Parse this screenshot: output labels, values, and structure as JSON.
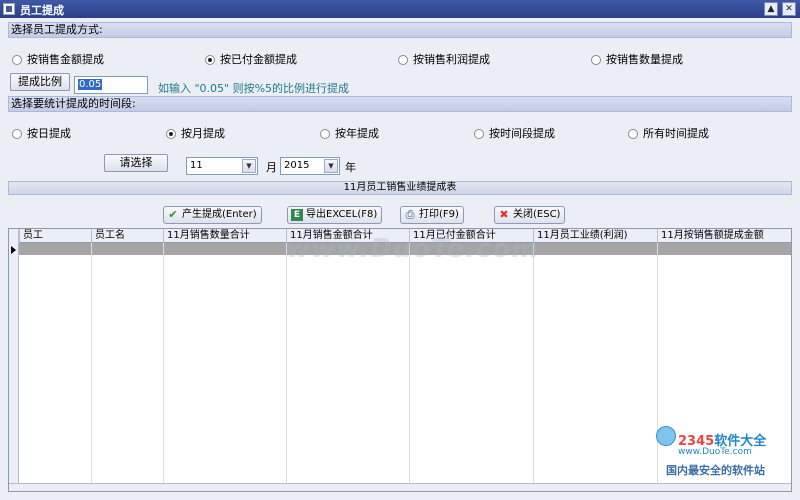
{
  "window": {
    "title": "员工提成",
    "pin_glyph": "▲",
    "close_glyph": "✕"
  },
  "method_section": {
    "label": "选择员工提成方式:",
    "options": [
      {
        "label": "按销售金额提成",
        "checked": false
      },
      {
        "label": "按已付金额提成",
        "checked": true
      },
      {
        "label": "按销售利润提成",
        "checked": false
      },
      {
        "label": "按销售数量提成",
        "checked": false
      }
    ]
  },
  "ratio": {
    "button_label": "提成比例",
    "value": "0.05",
    "hint": "如输入 \"0.05\" 则按%5的比例进行提成"
  },
  "period_section": {
    "label": "选择要统计提成的时间段:",
    "options": [
      {
        "label": "按日提成",
        "checked": false
      },
      {
        "label": "按月提成",
        "checked": true
      },
      {
        "label": "按年提成",
        "checked": false
      },
      {
        "label": "按时间段提成",
        "checked": false
      },
      {
        "label": "所有时间提成",
        "checked": false
      }
    ],
    "choose_button": "请选择",
    "month_value": "11",
    "month_unit": "月",
    "year_value": "2015",
    "year_unit": "年",
    "combo_arrow": "▼"
  },
  "report_title": "11月员工销售业绩提成表",
  "actions": [
    {
      "label": "产生提成(Enter)",
      "icon": "check-icon",
      "glyph": "✔",
      "color": "#2E8B2E"
    },
    {
      "label": "导出EXCEL(F8)",
      "icon": "excel-icon",
      "glyph": "E",
      "color": "#1E7A3A"
    },
    {
      "label": "打印(F9)",
      "icon": "printer-icon",
      "glyph": "⎙",
      "color": "#2A5B9E"
    },
    {
      "label": "关闭(ESC)",
      "icon": "close-icon",
      "glyph": "✖",
      "color": "#D33"
    }
  ],
  "grid": {
    "columns": [
      "员工",
      "员工名",
      "11月销售数量合计",
      "11月销售金额合计",
      "11月已付金额合计",
      "11月员工业绩(利润)",
      "11月按销售额提成金额"
    ]
  },
  "watermark": "www.DuoTe.com",
  "logo": {
    "brand_number": "2345",
    "brand_suffix": "软件大全",
    "url": "www.DuoTe.com",
    "slogan": "国内最安全的软件站"
  }
}
